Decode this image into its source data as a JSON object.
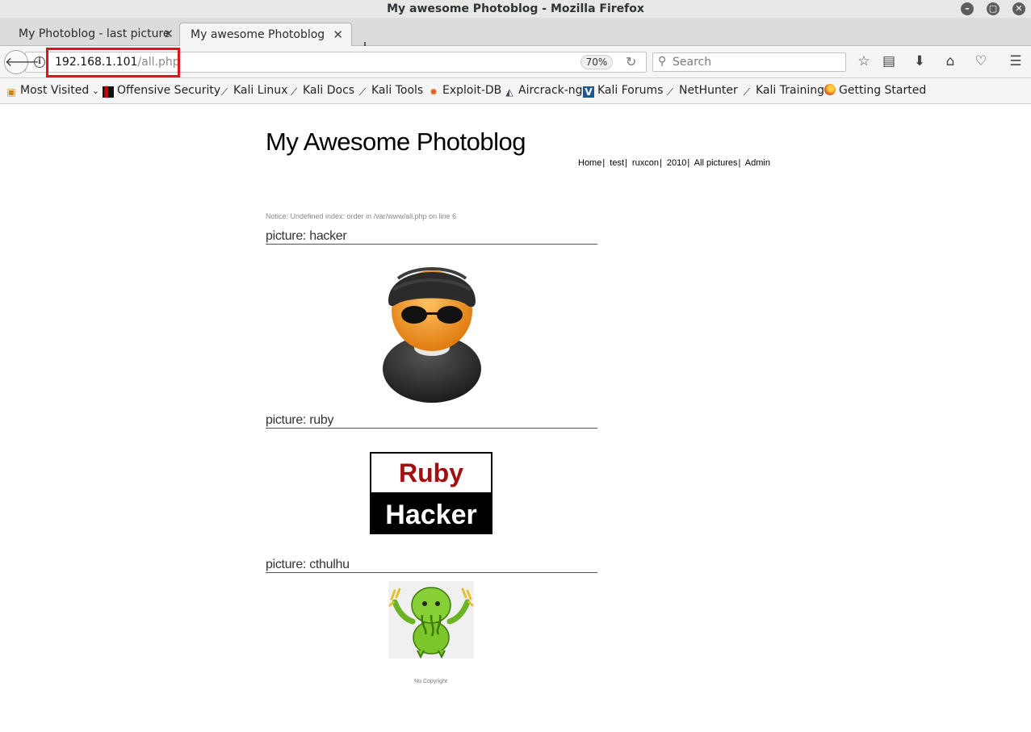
{
  "window": {
    "title": "My awesome Photoblog - Mozilla Firefox"
  },
  "tabs": [
    {
      "label": "My Photoblog - last picture",
      "active": false
    },
    {
      "label": "My awesome Photoblog",
      "active": true
    }
  ],
  "navbar": {
    "url_host": "192.168.1.101",
    "url_path": "/all.php",
    "zoom": "70%",
    "search_placeholder": "Search"
  },
  "bookmarks": [
    {
      "label": "Most Visited",
      "icon": "folder-icon"
    },
    {
      "label": "Offensive Security",
      "icon": "offsec-icon"
    },
    {
      "label": "Kali Linux",
      "icon": "kali-dragon-icon"
    },
    {
      "label": "Kali Docs",
      "icon": "kali-dragon-icon"
    },
    {
      "label": "Kali Tools",
      "icon": "kali-dragon-icon"
    },
    {
      "label": "Exploit-DB",
      "icon": "exploitdb-icon"
    },
    {
      "label": "Aircrack-ng",
      "icon": "aircrack-icon"
    },
    {
      "label": "Kali Forums",
      "icon": "kali-forums-icon"
    },
    {
      "label": "NetHunter",
      "icon": "kali-dragon-icon"
    },
    {
      "label": "Kali Training",
      "icon": "kali-dragon-icon"
    },
    {
      "label": "Getting Started",
      "icon": "firefox-icon"
    }
  ],
  "page": {
    "title": "My Awesome Photoblog",
    "nav": [
      "Home",
      "test",
      "ruxcon",
      "2010",
      "All pictures",
      "Admin"
    ],
    "nav_separator": "|",
    "notice": "Notice: Undefined index: order in /var/www/all.php on line 6",
    "pictures": [
      {
        "heading": "picture: hacker"
      },
      {
        "heading": "picture: ruby",
        "logo_top": "Ruby",
        "logo_bottom": "Hacker"
      },
      {
        "heading": "picture: cthulhu"
      }
    ],
    "footer": "No Copyright"
  },
  "colors": {
    "highlight_box": "#e0141e",
    "ruby_red": "#a01010"
  }
}
